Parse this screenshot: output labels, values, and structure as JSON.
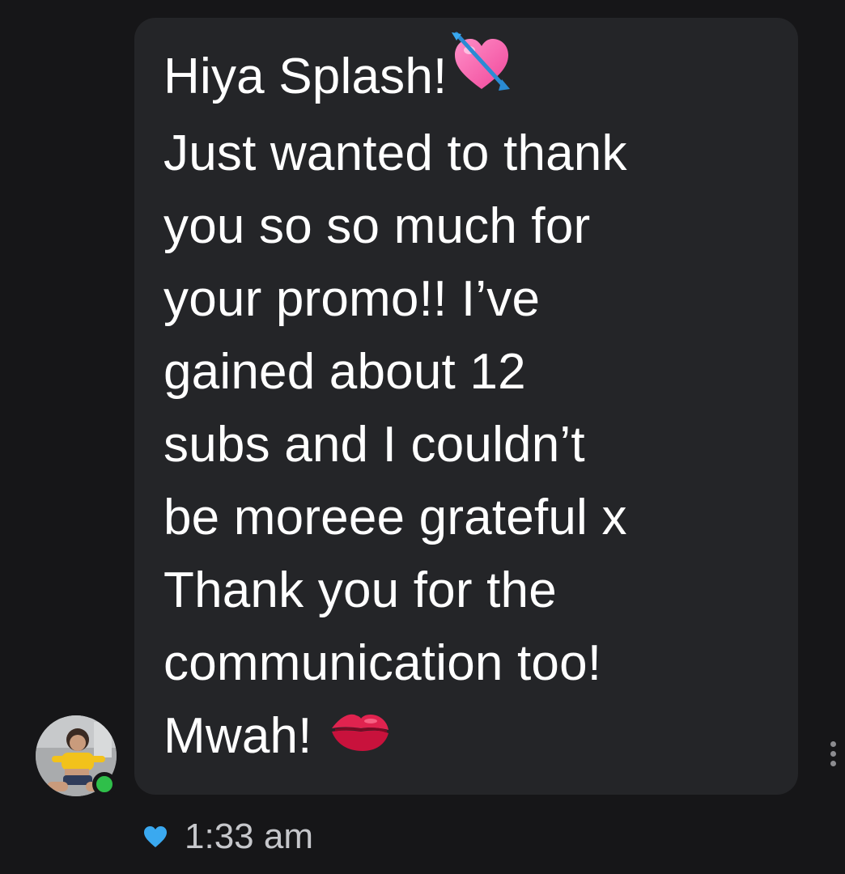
{
  "message": {
    "lines": [
      "Hiya Splash!",
      "Just wanted to thank",
      "you so so much for",
      "your promo!! I’ve",
      "gained about 12",
      "subs and I couldn’t",
      "be moreee grateful x",
      "Thank you for the",
      "communication too!",
      "Mwah!"
    ],
    "emojis": {
      "line_1": "heart-with-arrow-emoji",
      "line_10": "kiss-mark-emoji"
    }
  },
  "sender": {
    "online": true
  },
  "meta": {
    "like_icon": "heart-icon",
    "like_color": "#3aa9f0",
    "timestamp": "1:33 am"
  },
  "colors": {
    "background": "#161618",
    "bubble": "#242528",
    "text": "#ffffff",
    "online": "#2fbf4a"
  }
}
